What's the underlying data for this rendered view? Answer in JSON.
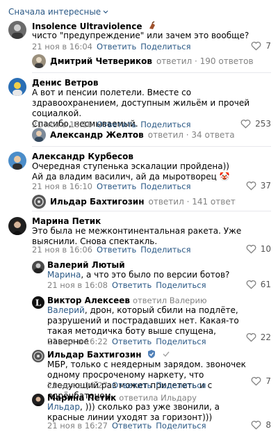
{
  "sort": {
    "label": "Сначала интересные"
  },
  "comments": [
    {
      "author": "Insolence Ultraviolence",
      "text": "чисто \"предупреждение\" или зачем это вообще?",
      "date": "21 ноя в 16:04",
      "reply": "Ответить",
      "share": "Поделиться",
      "likes": "7",
      "thread": {
        "name": "Дмитрий Четвериков",
        "info": "ответил · 190 ответов"
      }
    },
    {
      "author": "Денис Ветров",
      "text": "А вот и пенсии полетели. Вместе со здравоохранением, доступным жильём и прочей социалкой.",
      "text2": "Спасибо, несмываемый.",
      "date": "21 ноя в 16:16",
      "reply": "Ответить",
      "share": "Поделиться",
      "likes": "253",
      "thread": {
        "name": "Александр Желтов",
        "info": "ответил · 34 ответа"
      }
    },
    {
      "author": "Александр Курбесов",
      "text": "Очередная ступенька эскалации пройдена))",
      "text2": "Ай да владим василич, ай да мыротворец 🤡",
      "date": "21 ноя в 16:10",
      "reply": "Ответить",
      "share": "Поделиться",
      "likes": "37",
      "thread": {
        "name": "Ильдар Бахтигозин",
        "info": "ответил · 141 ответ"
      }
    },
    {
      "author": "Марина Петик",
      "text": "Это была не межконтинентальная ракета. Уже выяснили. Снова спектакль.",
      "date": "21 ноя в 16:06",
      "reply": "Ответить",
      "share": "Поделиться",
      "likes": "10"
    }
  ],
  "replies": [
    {
      "author": "Валерий Лютый",
      "mention": "Марина",
      "text": ", а что это было по версии ботов?",
      "date": "21 ноя в 16:08",
      "reply": "Ответить",
      "share": "Поделиться",
      "likes": "61"
    },
    {
      "author": "Виктор Алексеев",
      "reply_to": "ответил Валерию",
      "mention": "Валерий",
      "text": ", дрон, который сбили на подлёте, разрушений и пострадавших нет. Какая-то такая методичка боту выше спущена, наверное",
      "date": "21 ноя в 16:22",
      "reply": "Ответить",
      "share": "Поделиться",
      "likes": "22"
    },
    {
      "author": "Ильдар Бахтигозин",
      "text": "МБР, только с неядерным зарядом. звоночек одному просроченому наркету, что следующий раз может прилететь и с ядрёнбатоном.",
      "date": "21 ноя в 16:27",
      "reply": "Ответить",
      "share": "Поделиться",
      "likes": "7"
    },
    {
      "author": "Марина Петик",
      "reply_to": "ответила Ильдару",
      "mention": "Ильдар",
      "text": ", ))) сколько раз уже звонили, а красные линии уходят за горизонт)))",
      "date": "21 ноя в 16:27",
      "reply": "Ответить",
      "share": "Поделиться",
      "likes": "8"
    }
  ],
  "colors": {
    "link": "#2a5885",
    "muted": "#828282",
    "separator": "#e7e8ec"
  }
}
